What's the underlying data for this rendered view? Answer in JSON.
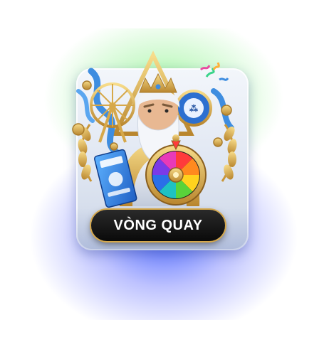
{
  "promo": {
    "button_label": "VÒNG QUAY",
    "icons": [
      "zeus-icon",
      "prize-wheel-icon",
      "ferris-wheel-icon",
      "lottery-ticket-icon",
      "laurel-wreath-icon",
      "coin-icon",
      "bingo-ball-icon",
      "confetti-icon"
    ]
  },
  "colors": {
    "glow_top": "#78f078",
    "glow_bottom": "#3c5aff",
    "card": "#dfe6f2",
    "button_bg": "#111111",
    "button_border": "#d6a84a",
    "button_text": "#ffffff",
    "gold": "#d6a84a",
    "ribbon": "#3e8de0"
  }
}
